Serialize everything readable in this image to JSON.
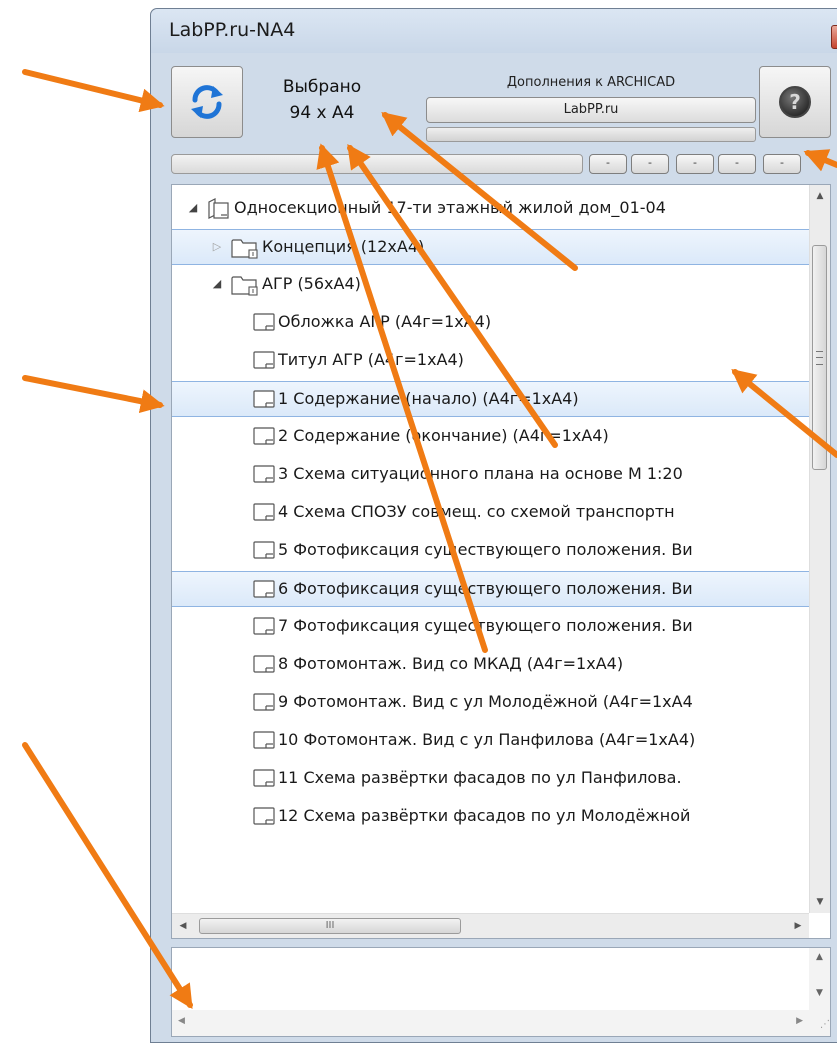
{
  "window": {
    "title": "LabPP.ru-NA4",
    "close_label": "x"
  },
  "toolbar": {
    "refresh_icon": "refresh-icon",
    "selected_label": "Выбрано",
    "selected_count": "94 x A4",
    "addons_label": "Дополнения к ARCHICAD",
    "labpp_button": "LabPP.ru",
    "help_icon": "help-icon",
    "help_glyph": "?",
    "mini_buttons": [
      "-",
      "-",
      "-",
      "-",
      "-"
    ]
  },
  "tree": {
    "rows": [
      {
        "label": "Односекционный 17-ти этажный жилой дом_01-04",
        "icon": "project-icon",
        "expander": "expanded",
        "level": 0,
        "selected": false
      },
      {
        "label": "Концепция (12xA4)",
        "icon": "folder-icon",
        "expander": "collapsed",
        "level": 1,
        "selected": true
      },
      {
        "label": "АГР (56xA4)",
        "icon": "folder-icon",
        "expander": "expanded",
        "level": 1,
        "selected": false
      },
      {
        "label": "Обложка АГР (А4г=1хА4)",
        "icon": "sheet-icon",
        "expander": "none",
        "level": 2,
        "selected": false
      },
      {
        "label": "Титул АГР (А4г=1хА4)",
        "icon": "sheet-icon",
        "expander": "none",
        "level": 2,
        "selected": false
      },
      {
        "label": "1 Содержание (начало) (А4г=1хА4)",
        "icon": "sheet-icon",
        "expander": "none",
        "level": 2,
        "selected": true
      },
      {
        "label": "2 Содержание (окончание) (А4г=1хА4)",
        "icon": "sheet-icon",
        "expander": "none",
        "level": 2,
        "selected": false
      },
      {
        "label": "3 Схема ситуационного плана на основе М 1:20",
        "icon": "sheet-icon",
        "expander": "none",
        "level": 2,
        "selected": false
      },
      {
        "label": "4 Схема СПОЗУ совмещ. со схемой транспортн",
        "icon": "sheet-icon",
        "expander": "none",
        "level": 2,
        "selected": false
      },
      {
        "label": "5 Фотофиксация существующего положения. Ви",
        "icon": "sheet-icon",
        "expander": "none",
        "level": 2,
        "selected": false
      },
      {
        "label": "6 Фотофиксация существующего положения. Ви",
        "icon": "sheet-icon",
        "expander": "none",
        "level": 2,
        "selected": true
      },
      {
        "label": "7 Фотофиксация существующего положения. Ви",
        "icon": "sheet-icon",
        "expander": "none",
        "level": 2,
        "selected": false
      },
      {
        "label": "8 Фотомонтаж. Вид со МКАД (А4г=1хА4)",
        "icon": "sheet-icon",
        "expander": "none",
        "level": 2,
        "selected": false
      },
      {
        "label": "9 Фотомонтаж. Вид с ул Молодёжной (А4г=1хА4",
        "icon": "sheet-icon",
        "expander": "none",
        "level": 2,
        "selected": false
      },
      {
        "label": "10 Фотомонтаж. Вид с ул Панфилова (А4г=1хА4)",
        "icon": "sheet-icon",
        "expander": "none",
        "level": 2,
        "selected": false
      },
      {
        "label": "11 Схема развёртки фасадов по ул Панфилова.",
        "icon": "sheet-icon",
        "expander": "none",
        "level": 2,
        "selected": false
      },
      {
        "label": "12 Схема развёртки фасадов по ул Молодёжной",
        "icon": "sheet-icon",
        "expander": "none",
        "level": 2,
        "selected": false
      }
    ],
    "hscroll_grip": "III",
    "vscroll_up_icon": "arrow-up-icon",
    "vscroll_down_icon": "arrow-down-icon",
    "hscroll_left_icon": "arrow-left-icon",
    "hscroll_right_icon": "arrow-right-icon"
  },
  "bottom_panel": {
    "text": ""
  },
  "colors": {
    "annotation_arrow": "#f07b14",
    "selection_border": "#8fb4e2",
    "refresh_icon": "#1f74d6"
  }
}
